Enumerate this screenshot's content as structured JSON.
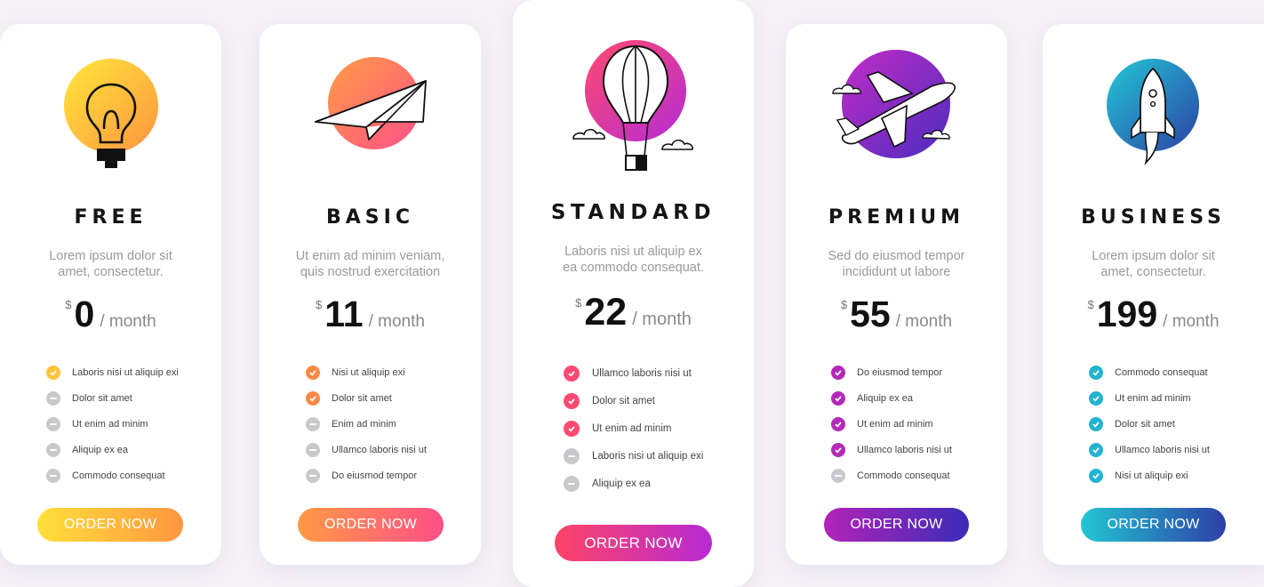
{
  "currency": "$",
  "colors": {
    "free": [
      "#ffe03a",
      "#ff9f40"
    ],
    "basic": [
      "#ff9e44",
      "#ff4f88"
    ],
    "standard": [
      "#ff4a6c",
      "#b52bd6"
    ],
    "premium": [
      "#bb22c6",
      "#4a2dbf"
    ],
    "business": [
      "#23c6d6",
      "#2c43a6"
    ],
    "disabled": "#c9c9cc"
  },
  "plans": [
    {
      "id": "free",
      "title": "FREE",
      "icon": "lightbulb-icon",
      "desc": [
        "Lorem ipsum dolor sit",
        "amet, consectetur."
      ],
      "price": "0",
      "period": "/ month",
      "features": [
        {
          "label": "Laboris nisi ut aliquip exi",
          "included": true
        },
        {
          "label": "Dolor sit amet",
          "included": false
        },
        {
          "label": "Ut enim ad minim",
          "included": false
        },
        {
          "label": "Aliquip ex ea",
          "included": false
        },
        {
          "label": "Commodo consequat",
          "included": false
        }
      ],
      "cta": "ORDER NOW"
    },
    {
      "id": "basic",
      "title": "BASIC",
      "icon": "paper-plane-icon",
      "desc": [
        "Ut enim ad minim veniam,",
        "quis nostrud exercitation"
      ],
      "price": "11",
      "period": "/ month",
      "features": [
        {
          "label": "Nisi ut aliquip exi",
          "included": true
        },
        {
          "label": "Dolor sit amet",
          "included": true
        },
        {
          "label": "Enim ad minim",
          "included": false
        },
        {
          "label": "Ullamco laboris nisi ut",
          "included": false
        },
        {
          "label": "Do eiusmod tempor",
          "included": false
        }
      ],
      "cta": "ORDER NOW"
    },
    {
      "id": "standard",
      "title": "STANDARD",
      "icon": "hot-air-balloon-icon",
      "desc": [
        "Laboris nisi ut aliquip ex",
        "ea commodo consequat."
      ],
      "price": "22",
      "period": "/ month",
      "features": [
        {
          "label": "Ullamco laboris nisi ut",
          "included": true
        },
        {
          "label": "Dolor sit amet",
          "included": true
        },
        {
          "label": "Ut enim ad minim",
          "included": true
        },
        {
          "label": "Laboris nisi ut aliquip exi",
          "included": false
        },
        {
          "label": "Aliquip ex ea",
          "included": false
        }
      ],
      "cta": "ORDER NOW"
    },
    {
      "id": "premium",
      "title": "PREMIUM",
      "icon": "airplane-icon",
      "desc": [
        "Sed do eiusmod tempor",
        "incididunt ut labore"
      ],
      "price": "55",
      "period": "/ month",
      "features": [
        {
          "label": "Do eiusmod tempor",
          "included": true
        },
        {
          "label": "Aliquip ex ea",
          "included": true
        },
        {
          "label": "Ut enim ad minim",
          "included": true
        },
        {
          "label": "Ullamco laboris nisi ut",
          "included": true
        },
        {
          "label": "Commodo consequat",
          "included": false
        }
      ],
      "cta": "ORDER NOW"
    },
    {
      "id": "business",
      "title": "BUSINESS",
      "icon": "rocket-icon",
      "desc": [
        "Lorem ipsum dolor sit",
        "amet, consectetur."
      ],
      "price": "199",
      "period": "/ month",
      "features": [
        {
          "label": "Commodo consequat",
          "included": true
        },
        {
          "label": "Ut enim ad minim",
          "included": true
        },
        {
          "label": "Dolor sit amet",
          "included": true
        },
        {
          "label": "Ullamco laboris nisi ut",
          "included": true
        },
        {
          "label": "Nisi ut aliquip exi",
          "included": true
        }
      ],
      "cta": "ORDER NOW"
    }
  ]
}
